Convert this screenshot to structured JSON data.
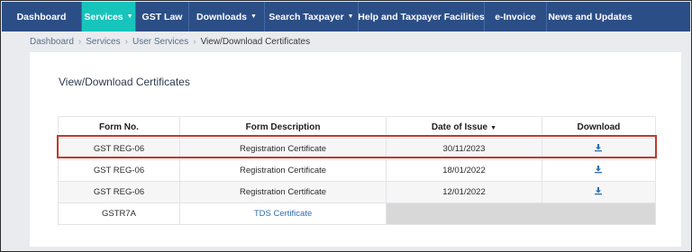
{
  "nav": {
    "items": [
      {
        "label": "Dashboard",
        "dropdown": false,
        "active": false
      },
      {
        "label": "Services",
        "dropdown": true,
        "active": true
      },
      {
        "label": "GST Law",
        "dropdown": false,
        "active": false
      },
      {
        "label": "Downloads",
        "dropdown": true,
        "active": false
      },
      {
        "label": "Search Taxpayer",
        "dropdown": true,
        "active": false
      },
      {
        "label": "Help and Taxpayer Facilities",
        "dropdown": false,
        "active": false
      },
      {
        "label": "e-Invoice",
        "dropdown": false,
        "active": false
      },
      {
        "label": "News and Updates",
        "dropdown": false,
        "active": false
      }
    ]
  },
  "breadcrumb": {
    "dashboard": "Dashboard",
    "services": "Services",
    "user_services": "User Services",
    "current": "View/Download Certificates"
  },
  "page": {
    "title": "View/Download Certificates"
  },
  "table": {
    "headers": {
      "form_no": "Form No.",
      "form_description": "Form Description",
      "date_of_issue": "Date of Issue",
      "download": "Download"
    },
    "rows": [
      {
        "form_no": "GST REG-06",
        "description": "Registration Certificate",
        "date": "30/11/2023",
        "highlighted": true
      },
      {
        "form_no": "GST REG-06",
        "description": "Registration Certificate",
        "date": "18/01/2022",
        "highlighted": false
      },
      {
        "form_no": "GST REG-06",
        "description": "Registration Certificate",
        "date": "12/01/2022",
        "highlighted": false
      },
      {
        "form_no": "GSTR7A",
        "description": "TDS Certificate",
        "date": "",
        "highlighted": false
      }
    ]
  },
  "icons": {
    "download": "download-icon",
    "sort": "sort-desc-caret-icon",
    "dropdown": "caret-down-icon"
  },
  "colors": {
    "nav_bg": "#2c4e86",
    "nav_active": "#17c4bb",
    "link": "#2c6eb0",
    "highlight_border": "#c0392b"
  }
}
